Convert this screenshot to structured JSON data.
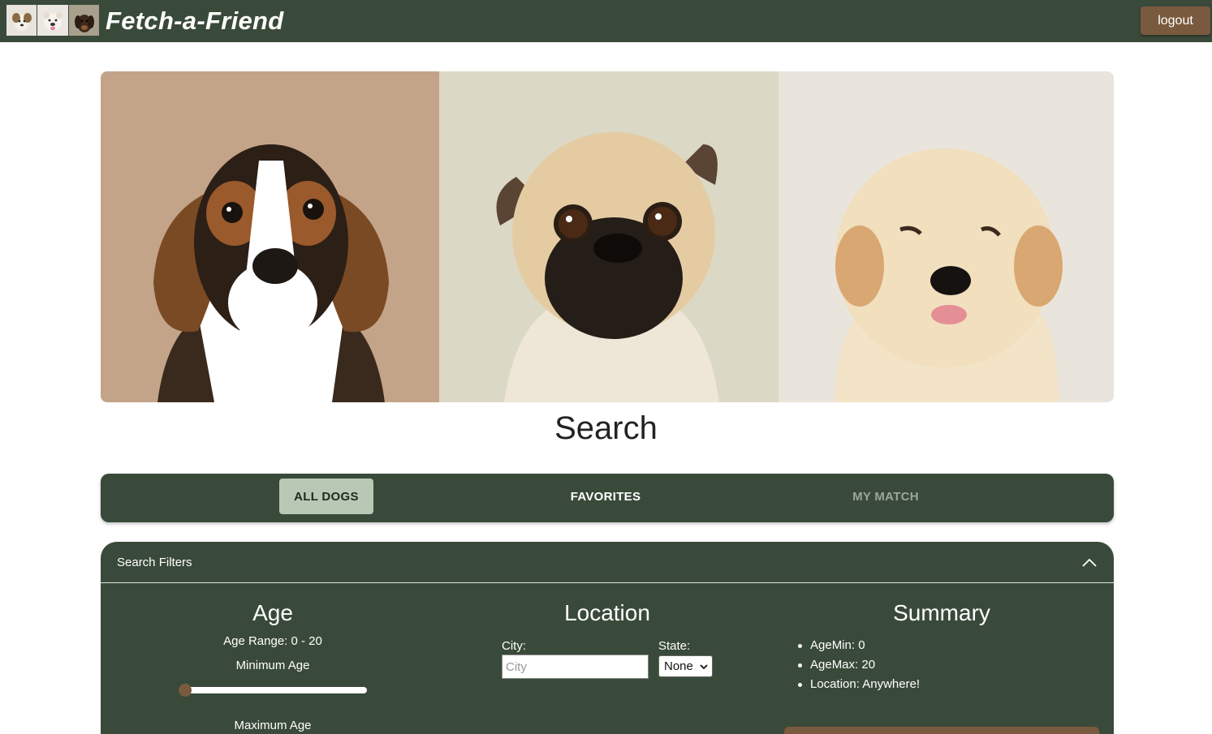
{
  "header": {
    "brand": "Fetch-a-Friend",
    "logout_label": "logout",
    "logo_icons": [
      "jack-russell-icon",
      "bulldog-icon",
      "dachshund-icon"
    ]
  },
  "hero": {
    "images": [
      "beagle-puppy-photo",
      "pug-puppy-photo",
      "golden-retriever-puppy-photo"
    ]
  },
  "page": {
    "title": "Search"
  },
  "tabs": [
    {
      "label": "ALL DOGS",
      "active": true
    },
    {
      "label": "FAVORITES",
      "active": false
    },
    {
      "label": "MY MATCH",
      "active": false,
      "disabled": true
    }
  ],
  "filters": {
    "title": "Search Filters",
    "expanded": true,
    "age": {
      "heading": "Age",
      "range_text": "Age Range: 0 - 20",
      "min_label": "Minimum Age",
      "min_value": 0,
      "max_label": "Maximum Age"
    },
    "location": {
      "heading": "Location",
      "city_label": "City:",
      "city_placeholder": "City",
      "city_value": "",
      "state_label": "State:",
      "state_value": "None"
    },
    "summary": {
      "heading": "Summary",
      "items": [
        "AgeMin: 0",
        "AgeMax: 20",
        "Location: Anywhere!"
      ]
    }
  },
  "colors": {
    "primary": "#3a4a3a",
    "accent": "#7a5a3e",
    "active_tab": "#b8c8b4"
  }
}
